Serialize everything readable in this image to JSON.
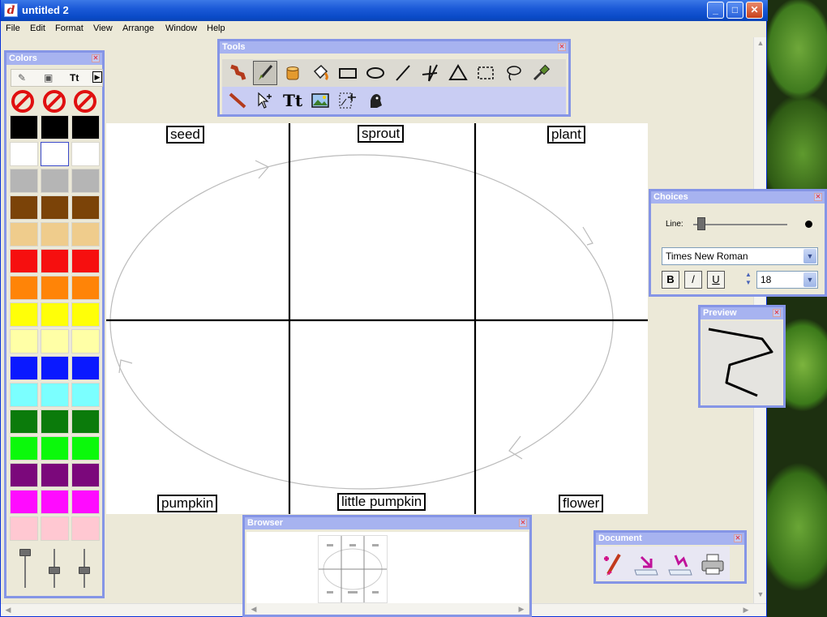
{
  "window": {
    "app_icon": "d",
    "title": "untitled 2",
    "minimize_icon": "minimize-icon",
    "maximize_icon": "maximize-icon",
    "close_icon": "close-icon"
  },
  "menu": [
    "File",
    "Edit",
    "Format",
    "View",
    "Arrange",
    "Window",
    "Help"
  ],
  "palettes": {
    "colors": {
      "title": "Colors",
      "text_tool": "Tt",
      "swatch_rows": [
        [
          "#000000",
          "#000000",
          "#000000"
        ],
        [
          "#ffffff",
          "#ffffff",
          "#ffffff"
        ],
        [
          "#b5b5b5",
          "#b5b5b5",
          "#b5b5b5"
        ],
        [
          "#7b4308",
          "#7b4308",
          "#7b4308"
        ],
        [
          "#efcc8c",
          "#efcc8c",
          "#efcc8c"
        ],
        [
          "#f60f0f",
          "#f60f0f",
          "#f60f0f"
        ],
        [
          "#ff8407",
          "#ff8407",
          "#ff8407"
        ],
        [
          "#ffff08",
          "#ffff08",
          "#ffff08"
        ],
        [
          "#ffffa6",
          "#ffffa6",
          "#ffffa6"
        ],
        [
          "#0a19ff",
          "#0a19ff",
          "#0a19ff"
        ],
        [
          "#7bffff",
          "#7bffff",
          "#7bffff"
        ],
        [
          "#0b7b0b",
          "#0b7b0b",
          "#0b7b0b"
        ],
        [
          "#0bf90b",
          "#0bf90b",
          "#0bf90b"
        ],
        [
          "#7b087b",
          "#7b087b",
          "#7b087b"
        ],
        [
          "#ff0bff",
          "#ff0bff",
          "#ff0bff"
        ],
        [
          "#ffc8d2",
          "#ffc8d2",
          "#ffc8d2"
        ]
      ],
      "selected_swatch": "white-2",
      "slider_levels": [
        0.0,
        0.55,
        0.55
      ]
    },
    "tools": {
      "title": "Tools",
      "row1": [
        "marker-icon",
        "brush-icon",
        "bucket-icon",
        "paint-can-icon",
        "rectangle-icon",
        "ellipse-icon",
        "line-icon",
        "polyline-icon",
        "triangle-icon",
        "marquee-select-icon",
        "lasso-icon",
        "eyedropper-icon"
      ],
      "row2": [
        "pencil-icon",
        "pointer-add-icon",
        "text-tool-icon",
        "image-icon",
        "image-trace-icon",
        "stamp-icon"
      ],
      "active_tool": "brush-icon",
      "text_tool_label": "Tt"
    },
    "choices": {
      "title": "Choices",
      "line_label": "Line:",
      "line_width": 0.05,
      "font": "Times New Roman",
      "bold_label": "B",
      "italic_label": "/",
      "underline_label": "U",
      "size": "18"
    },
    "preview": {
      "title": "Preview"
    },
    "browser": {
      "title": "Browser"
    },
    "document": {
      "title": "Document",
      "buttons": [
        "new-page-icon",
        "export-icon",
        "import-icon",
        "print-icon"
      ]
    }
  },
  "canvas": {
    "labels": {
      "seed": "seed",
      "sprout": "sprout",
      "plant": "plant",
      "pumpkin": "pumpkin",
      "little_pumpkin": "little pumpkin",
      "flower": "flower"
    }
  }
}
